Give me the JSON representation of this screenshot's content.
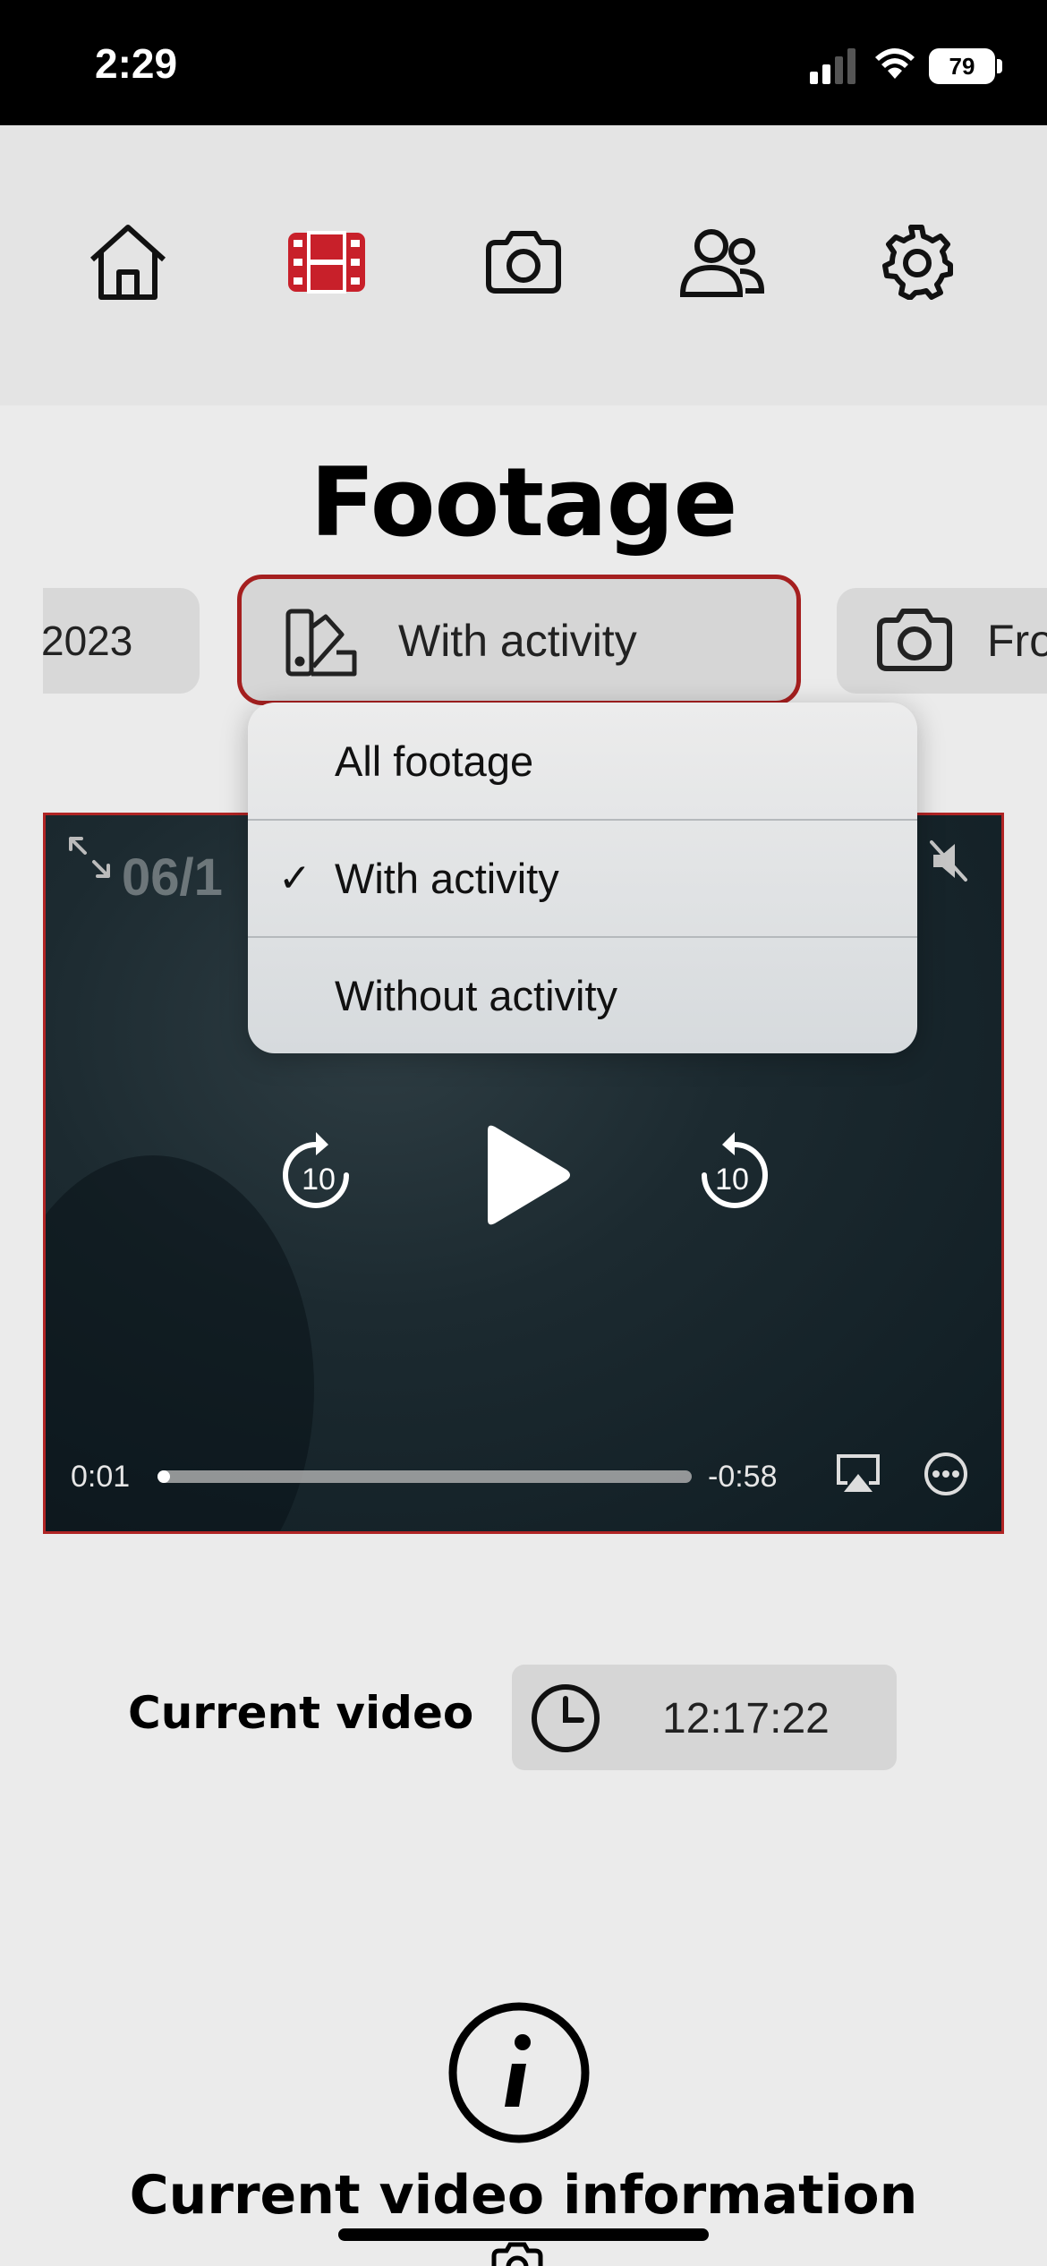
{
  "status_bar": {
    "time": "2:29",
    "battery": "79",
    "icons": [
      "cellular-signal-icon",
      "wifi-icon",
      "battery-icon"
    ]
  },
  "nav": {
    "items": [
      {
        "name": "home",
        "icon": "home-icon",
        "active": false
      },
      {
        "name": "footage",
        "icon": "film-icon",
        "active": true
      },
      {
        "name": "camera",
        "icon": "camera-icon",
        "active": false
      },
      {
        "name": "users",
        "icon": "users-icon",
        "active": false
      },
      {
        "name": "settings",
        "icon": "gear-icon",
        "active": false
      }
    ],
    "accent_color": "#c8202a"
  },
  "page": {
    "title": "Footage"
  },
  "filters": {
    "date_label": "2023",
    "activity_label": "With activity",
    "camera_label": "Fro",
    "activity_icon": "swatch-icon",
    "camera_icon": "camera-icon"
  },
  "dropdown": {
    "options": [
      {
        "label": "All footage",
        "selected": false
      },
      {
        "label": "With activity",
        "selected": true
      },
      {
        "label": "Without activity",
        "selected": false
      }
    ],
    "check_mark": "✓"
  },
  "video": {
    "date_overlay": "06/1",
    "elapsed": "0:01",
    "remaining": "-0:58",
    "progress_fraction": 0.01,
    "skip_seconds": "10",
    "controls": [
      "expand-icon",
      "mute-icon",
      "rewind-10-icon",
      "play-icon",
      "forward-10-icon",
      "airplay-icon",
      "more-icon"
    ]
  },
  "current_video": {
    "label": "Current video",
    "time": "12:17:22",
    "icon": "clock-icon"
  },
  "info_section": {
    "title": "Current video information",
    "icon": "info-icon"
  }
}
